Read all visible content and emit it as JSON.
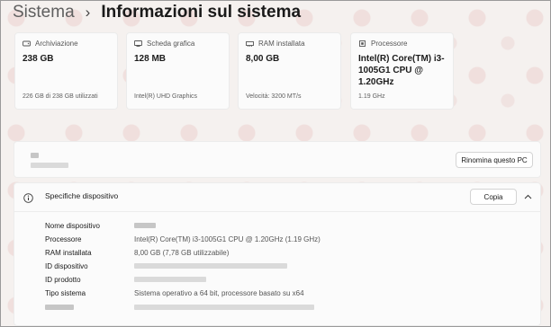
{
  "breadcrumb": {
    "parent": "Sistema",
    "separator": "›",
    "current": "Informazioni sul sistema"
  },
  "cards": [
    {
      "icon": "storage-icon",
      "title": "Archiviazione",
      "value": "238 GB",
      "sub": "226 GB di 238 GB utilizzati"
    },
    {
      "icon": "graphics-card-icon",
      "title": "Scheda grafica",
      "value": "128 MB",
      "sub": "Intel(R) UHD Graphics"
    },
    {
      "icon": "ram-icon",
      "title": "RAM installata",
      "value": "8,00 GB",
      "sub": "Velocità: 3200 MT/s"
    },
    {
      "icon": "processor-icon",
      "title": "Processore",
      "value": "Intel(R) Core(TM) i3-1005G1 CPU @ 1.20GHz",
      "sub": "1.19 GHz"
    }
  ],
  "rename_button": "Rinomina questo PC",
  "specs": {
    "title": "Specifiche dispositivo",
    "copy_button": "Copia",
    "rows": [
      {
        "label": "Nome dispositivo",
        "value": ""
      },
      {
        "label": "Processore",
        "value": "Intel(R) Core(TM) i3-1005G1 CPU @ 1.20GHz (1.19 GHz)"
      },
      {
        "label": "RAM installata",
        "value": "8,00 GB (7,78 GB utilizzabile)"
      },
      {
        "label": "ID dispositivo",
        "value": ""
      },
      {
        "label": "ID prodotto",
        "value": ""
      },
      {
        "label": "Tipo sistema",
        "value": "Sistema operativo a 64 bit, processore basato su x64"
      }
    ]
  },
  "colors": {
    "background": "#f5f1ef",
    "card": "#fbfbfb",
    "redacted": "#c6c6c6"
  }
}
